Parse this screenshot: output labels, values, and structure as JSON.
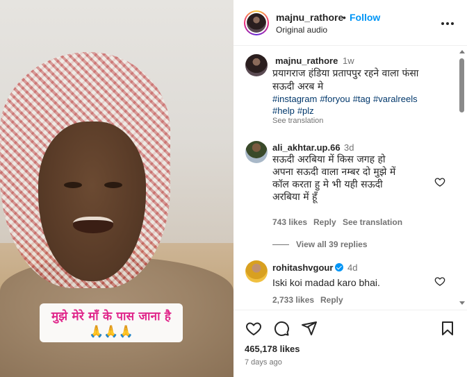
{
  "media": {
    "caption_line1": "मुझे मेरे माँ के पास जाना है",
    "caption_line2": "🙏🙏🙏"
  },
  "header": {
    "username": "majnu_rathore",
    "separator": "•",
    "follow_label": "Follow",
    "audio": "Original audio"
  },
  "post_caption": {
    "username": "majnu_rathore",
    "time": "1w",
    "text_line1": "प्रयागराज हंडिया प्रतापपुर रहने वाला फंसा",
    "text_line2": "सऊदी अरब मे",
    "tags": [
      "#instagram",
      "#foryou",
      "#tag",
      "#varalreels",
      "#help",
      "#plz"
    ],
    "see_translation": "See translation"
  },
  "comments": [
    {
      "username": "ali_akhtar.up.66",
      "time": "3d",
      "lines": [
        "सऊदी अरबिया में किस जगह हो",
        "अपना सऊदी वाला नम्बर दो मुझे में",
        "कॉल करता हु मे भी यही सऊदी",
        "अरबिया में हूँ"
      ],
      "likes": "743 likes",
      "reply": "Reply",
      "see_translation": "See translation",
      "view_replies": "View all 39 replies"
    },
    {
      "username": "rohitashvgour",
      "verified": true,
      "time": "4d",
      "text": "Iski koi madad karo bhai.",
      "likes": "2,733 likes",
      "reply": "Reply"
    }
  ],
  "footer": {
    "likes": "465,178 likes",
    "posted": "7 days ago"
  },
  "icons": [
    "heart-icon",
    "comment-icon",
    "share-icon",
    "bookmark-icon",
    "more-icon"
  ],
  "colors": {
    "link": "#0095f6",
    "tag": "#00376b",
    "caption_pink": "#e0258a"
  }
}
